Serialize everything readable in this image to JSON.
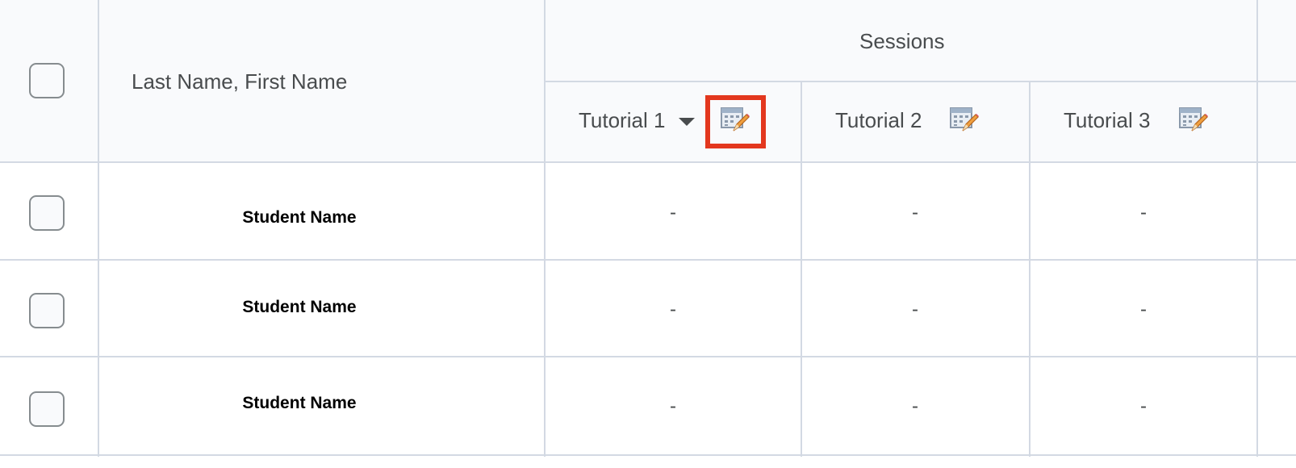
{
  "table": {
    "name_header": "Last Name, First Name",
    "group_header": "Sessions",
    "sessions": [
      {
        "label": "Tutorial 1",
        "has_dropdown": true,
        "icon": "edit-session-icon",
        "highlighted": true
      },
      {
        "label": "Tutorial 2",
        "has_dropdown": false,
        "icon": "edit-session-icon",
        "highlighted": false
      },
      {
        "label": "Tutorial 3",
        "has_dropdown": false,
        "icon": "edit-session-icon",
        "highlighted": false
      }
    ],
    "rows": [
      {
        "name": "Student Name",
        "values": [
          "-",
          "-",
          "-"
        ]
      },
      {
        "name": "Student Name",
        "values": [
          "-",
          "-",
          "-"
        ]
      },
      {
        "name": "Student Name",
        "values": [
          "-",
          "-",
          "-"
        ]
      }
    ]
  },
  "colors": {
    "border": "#d3d9e3",
    "header_bg": "#f9fafc",
    "highlight": "#e3371e",
    "text": "#494c4e"
  }
}
